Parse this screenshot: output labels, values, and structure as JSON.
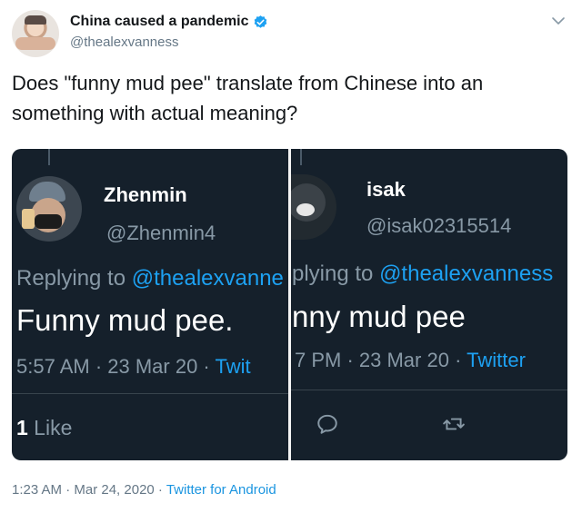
{
  "tweet": {
    "display_name": "China caused a pandemic",
    "handle": "@thealexvanness",
    "text": "Does \"funny mud pee\" translate from Chinese into an something with actual meaning?",
    "timestamp": "1:23 AM · Mar 24, 2020",
    "footer_sep": " · ",
    "client": "Twitter for Android"
  },
  "media": {
    "left": {
      "name": "Zhenmin",
      "handle": "@Zhenmin4",
      "reply_prefix": "Replying to ",
      "reply_mention": "@thealexvanne",
      "body": "Funny mud pee.",
      "meta_time": "5:57 AM · 23 Mar 20 · ",
      "meta_source": "Twit",
      "likes_count": "1",
      "likes_label": " Like"
    },
    "right": {
      "name": "isak",
      "handle": "@isak02315514",
      "reply_prefix": "plying to ",
      "reply_mention": "@thealexvanness",
      "body": "nny mud pee",
      "meta_time": "7 PM · 23 Mar 20 · ",
      "meta_source": "Twitter"
    }
  },
  "icons": {
    "verified": "verified-badge-icon",
    "chevron": "chevron-down-icon",
    "reply": "reply-icon",
    "retweet": "retweet-icon"
  },
  "colors": {
    "accent": "#1da1f2",
    "dark_bg": "#15202b",
    "muted": "#657786"
  }
}
